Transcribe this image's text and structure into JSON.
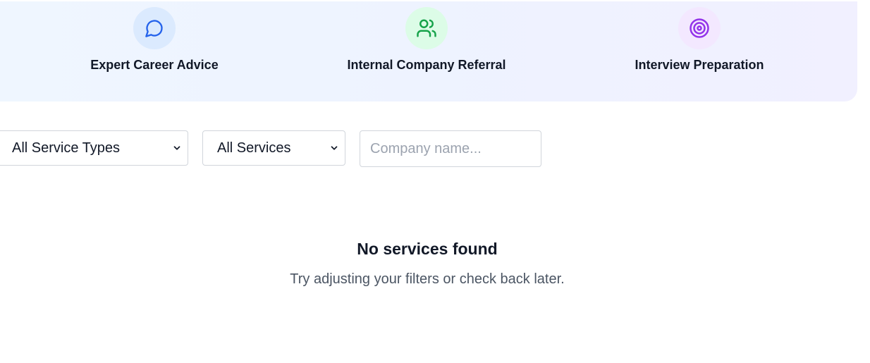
{
  "features": [
    {
      "label": "Expert Career Advice",
      "icon": "chat-bubble-icon",
      "icon_color": "#2563eb",
      "bg_color": "#dbeafe"
    },
    {
      "label": "Internal Company Referral",
      "icon": "users-icon",
      "icon_color": "#16a34a",
      "bg_color": "#dcfce7"
    },
    {
      "label": "Interview Preparation",
      "icon": "target-icon",
      "icon_color": "#9333ea",
      "bg_color": "#f3e8ff"
    }
  ],
  "filters": {
    "service_type": {
      "selected": "All Service Types"
    },
    "service": {
      "selected": "All Services"
    },
    "company": {
      "placeholder": "Company name...",
      "value": ""
    }
  },
  "empty_state": {
    "title": "No services found",
    "subtitle": "Try adjusting your filters or check back later."
  }
}
